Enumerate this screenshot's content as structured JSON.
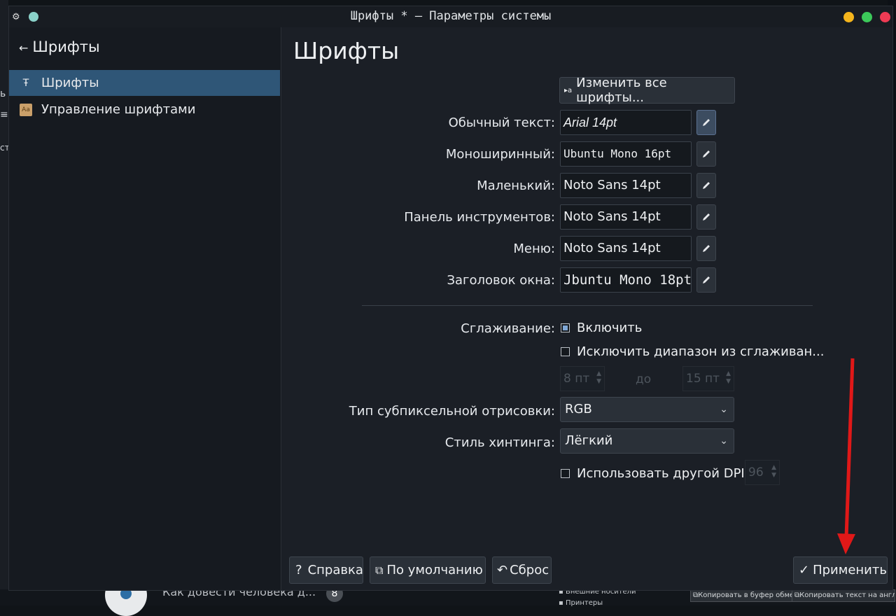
{
  "window": {
    "title": "Шрифты * — Параметры системы"
  },
  "sidebar": {
    "back_label": "Шрифты",
    "items": [
      {
        "label": "Шрифты",
        "icon": "font-icon"
      },
      {
        "label": "Управление шрифтами",
        "icon": "font-manager-icon"
      }
    ]
  },
  "main": {
    "title": "Шрифты",
    "change_all_button": "Изменить все шрифты...",
    "fonts": [
      {
        "label": "Обычный текст:",
        "value": "Arial 14pt"
      },
      {
        "label": "Моноширинный:",
        "value": "Ubuntu Mono 16pt"
      },
      {
        "label": "Маленький:",
        "value": "Noto Sans 14pt"
      },
      {
        "label": "Панель инструментов:",
        "value": "Noto Sans 14pt"
      },
      {
        "label": "Меню:",
        "value": "Noto Sans 14pt"
      },
      {
        "label": "Заголовок окна:",
        "value": "Jbuntu Mono 18pt"
      }
    ],
    "antialiasing": {
      "label": "Сглаживание:",
      "enable_label": "Включить",
      "enable_checked": true,
      "exclude_label": "Исключить диапазон из сглаживан...",
      "exclude_checked": false,
      "range_from": "8 пт",
      "range_to_label": "до",
      "range_to": "15 пт"
    },
    "subpixel": {
      "label": "Тип субпиксельной отрисовки:",
      "value": "RGB"
    },
    "hinting": {
      "label": "Стиль хинтинга:",
      "value": "Лёгкий"
    },
    "dpi": {
      "label": "Использовать другой DPI:",
      "checked": false,
      "value": "96"
    }
  },
  "footer": {
    "help": "Справка",
    "defaults": "По умолчанию",
    "reset": "Сброс",
    "apply": "Применить"
  },
  "background": {
    "taskbar_text": "Как довести человека д...",
    "taskbar_badge": "8",
    "left_chars": [
      "ь",
      "≡",
      "ст"
    ],
    "file_item_1": "Внешние носители",
    "file_item_2": "Принтеры",
    "clip_button_1": "Копировать в буфер обмена",
    "clip_button_2": "Копировать текст на английско"
  },
  "colors": {
    "window_bg": "#1b1f26",
    "sidebar_active": "#2f5677",
    "annotation_arrow": "#e01818"
  }
}
